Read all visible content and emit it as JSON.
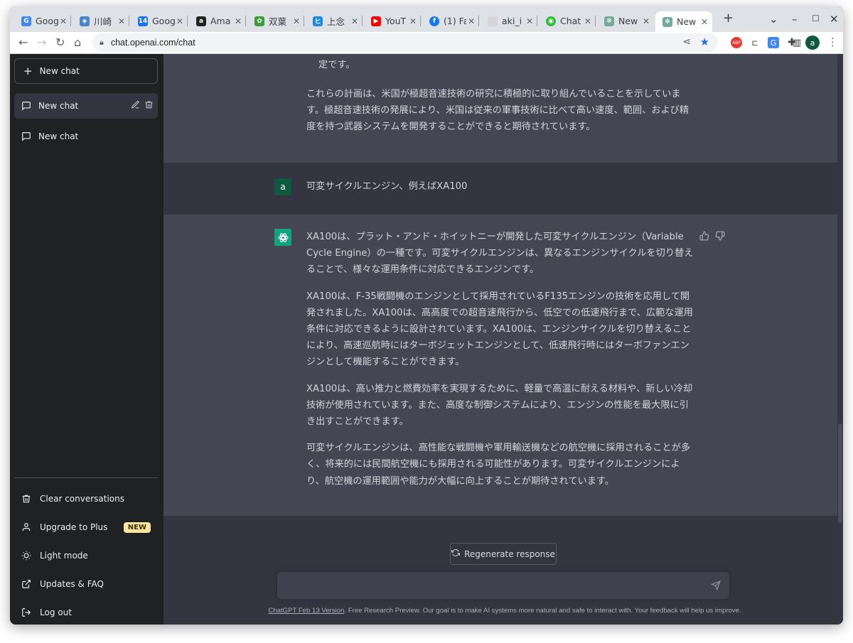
{
  "browser": {
    "tabs": [
      {
        "title": "Goog",
        "favicon": "google-icon",
        "color": "#4285f4"
      },
      {
        "title": "川崎",
        "favicon": "cube-icon",
        "color": "#4a86c7"
      },
      {
        "title": "Goog",
        "favicon": "calendar-icon",
        "color": "#1a73e8"
      },
      {
        "title": "Ama",
        "favicon": "amazon-icon",
        "color": "#222222"
      },
      {
        "title": "双葉",
        "favicon": "sprout-icon",
        "color": "#3a9d3a"
      },
      {
        "title": "上念",
        "favicon": "blog-icon",
        "color": "#1e88e5"
      },
      {
        "title": "YouT",
        "favicon": "youtube-icon",
        "color": "#ff0000"
      },
      {
        "title": "(1) Fa",
        "favicon": "facebook-icon",
        "color": "#1877f2"
      },
      {
        "title": "aki_i",
        "favicon": "image-icon",
        "color": "#bdbdbd"
      },
      {
        "title": "Chat",
        "favicon": "chat-icon",
        "color": "#2fbe3b"
      },
      {
        "title": "New",
        "favicon": "openai-icon",
        "color": "#74aa9c"
      },
      {
        "title": "New",
        "favicon": "openai-icon",
        "color": "#74aa9c"
      }
    ],
    "url": "chat.openai.com/chat",
    "profile_initial": "a"
  },
  "sidebar": {
    "new_chat_label": "New chat",
    "chats": [
      {
        "label": "New chat"
      },
      {
        "label": "New chat"
      }
    ],
    "links": {
      "clear": "Clear conversations",
      "upgrade": "Upgrade to Plus",
      "upgrade_badge": "NEW",
      "light_mode": "Light mode",
      "updates": "Updates & FAQ",
      "logout": "Log out"
    }
  },
  "conversation": {
    "prev_bot": {
      "tail": "定です。",
      "paragraph": "これらの計画は、米国が極超音速技術の研究に積極的に取り組んでいることを示しています。極超音速技術の発展により、米国は従来の軍事技術に比べて高い速度、範囲、および精度を持つ武器システムを開発することができると期待されています。"
    },
    "user": {
      "initial": "a",
      "text": "可変サイクルエンジン、例えばXA100"
    },
    "bot": {
      "paragraphs": [
        "XA100は、プラット・アンド・ホイットニーが開発した可変サイクルエンジン（Variable Cycle Engine）の一種です。可変サイクルエンジンは、異なるエンジンサイクルを切り替えることで、様々な運用条件に対応できるエンジンです。",
        "XA100は、F-35戦闘機のエンジンとして採用されているF135エンジンの技術を応用して開発されました。XA100は、高高度での超音速飛行から、低空での低速飛行まで、広範な運用条件に対応できるように設計されています。XA100は、エンジンサイクルを切り替えることにより、高速巡航時にはターボジェットエンジンとして、低速飛行時にはターボファンエンジンとして機能することができます。",
        "XA100は、高い推力と燃費効率を実現するために、軽量で高温に耐える材料や、新しい冷却技術が使用されています。また、高度な制御システムにより、エンジンの性能を最大限に引き出すことができます。",
        "可変サイクルエンジンは、高性能な戦闘機や軍用輸送機などの航空機に採用されることが多く、将来的には民間航空機にも採用される可能性があります。可変サイクルエンジンにより、航空機の運用範囲や能力が大幅に向上することが期待されています。"
      ]
    }
  },
  "composer": {
    "regenerate_label": "Regenerate response",
    "input_value": "",
    "footer_link": "ChatGPT Feb 13 Version",
    "footer_text": ". Free Research Preview. Our goal is to make AI systems more natural and safe to interact with. Your feedback will help us improve."
  },
  "colors": {
    "sidebar_bg": "#202123",
    "main_bg": "#343541",
    "bot_bg": "#444654",
    "accent": "#10a37f",
    "badge": "#fae69e"
  }
}
